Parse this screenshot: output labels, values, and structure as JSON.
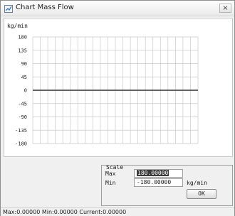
{
  "window": {
    "title": "Chart Mass Flow",
    "close_glyph": "×",
    "icon": "chart-window-icon"
  },
  "chart": {
    "unit_label": "kg/min",
    "y_ticks": [
      "180",
      "135",
      "90",
      "45",
      "0",
      "-45",
      "-90",
      "-135",
      "-180"
    ]
  },
  "chart_data": {
    "type": "line",
    "title": "",
    "xlabel": "",
    "ylabel": "kg/min",
    "ylim": [
      -180,
      180
    ],
    "yticks": [
      180,
      135,
      90,
      45,
      0,
      -45,
      -90,
      -135,
      -180
    ],
    "grid": true,
    "series": [
      {
        "values": [
          0,
          0
        ]
      }
    ],
    "colors": {
      "line": "#303030",
      "grid": "#c9c9c9"
    }
  },
  "scale": {
    "title": "Scale",
    "max_label": "Max",
    "max_value": "180.00000",
    "min_label": "Min",
    "min_value": "-180.00000",
    "unit": "kg/min",
    "ok_label": "OK"
  },
  "status": {
    "text": "Max:0.00000  Min:0.00000  Current:0.00000"
  }
}
